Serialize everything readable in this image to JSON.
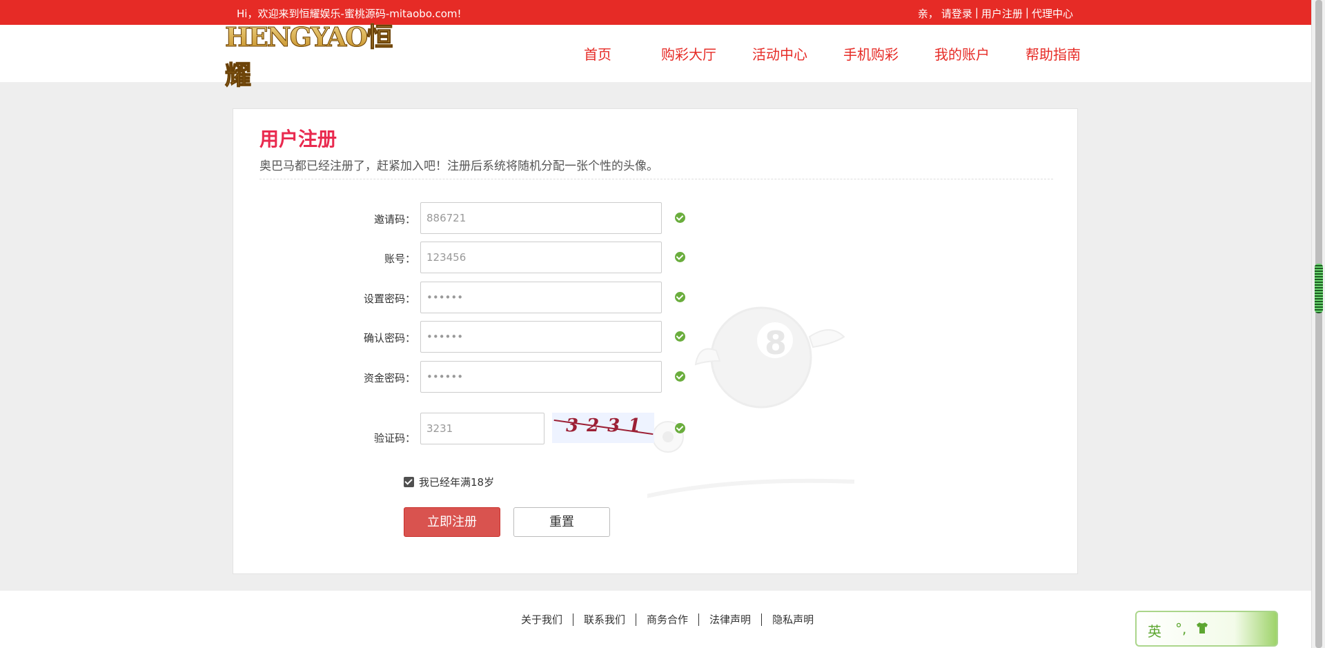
{
  "topbar": {
    "greeting": "Hi，欢迎来到恒耀娱乐-蜜桃源码-mitaobo.com!",
    "prefix": "亲，",
    "login": "请登录",
    "separator": "|",
    "register": "用户注册",
    "agent": "代理中心"
  },
  "header": {
    "logo_text": "HENGYAO恒耀",
    "nav": [
      "首页",
      "购彩大厅",
      "活动中心",
      "手机购彩",
      "我的账户",
      "帮助指南"
    ]
  },
  "form": {
    "title": "用户注册",
    "subtitle": "奥巴马都已经注册了，赶紧加入吧！注册后系统将随机分配一张个性的头像。",
    "fields": [
      {
        "label": "邀请码：",
        "value": "886721"
      },
      {
        "label": "账号：",
        "value": "123456"
      },
      {
        "label": "设置密码：",
        "value": "••••••"
      },
      {
        "label": "确认密码：",
        "value": "••••••"
      },
      {
        "label": "资金密码：",
        "value": "••••••"
      }
    ],
    "captcha": {
      "label": "验证码：",
      "value": "3231",
      "image_text": "3231"
    },
    "agree_label": "我已经年满18岁",
    "submit_label": "立即注册",
    "reset_label": "重置",
    "accent_color": "#e92a4f",
    "valid_color": "#6aad3d"
  },
  "footer": {
    "links": [
      "关于我们",
      "联系我们",
      "商务合作",
      "法律声明",
      "隐私声明"
    ]
  },
  "ime": {
    "mode": "英",
    "punct": "°,"
  }
}
